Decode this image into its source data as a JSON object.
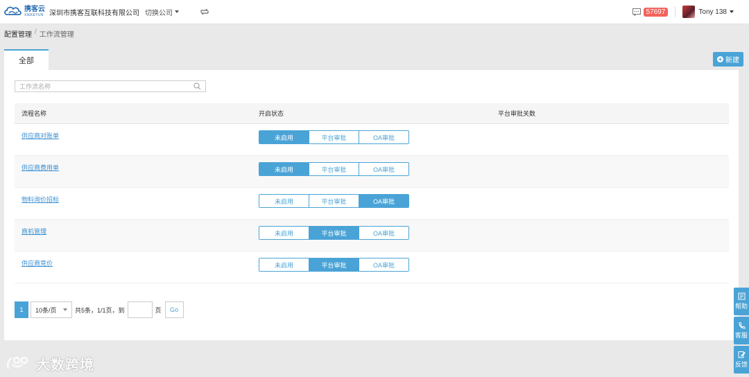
{
  "header": {
    "logo_cn": "携客云",
    "logo_en": "XIEKEYUN",
    "company": "深圳市携客互联科技有限公司",
    "switch_company": "切换公司",
    "message_count": "57697",
    "user_name": "Tony 138"
  },
  "breadcrumb": {
    "root": "配置管理",
    "separator": "/",
    "current": "工作流管理"
  },
  "tabs": {
    "active": "全部"
  },
  "toolbar": {
    "new_label": "新建"
  },
  "search": {
    "placeholder": "工作流名称"
  },
  "table": {
    "headers": [
      "流程名称",
      "开启状态",
      "平台审批关数"
    ],
    "options": [
      "未启用",
      "平台审批",
      "OA审批"
    ],
    "rows": [
      {
        "name": "供应商对账单",
        "status": "未启用"
      },
      {
        "name": "供应商费用单",
        "status": "未启用"
      },
      {
        "name": "物料询价招标",
        "status": "OA审批"
      },
      {
        "name": "商机管理",
        "status": "平台审批"
      },
      {
        "name": "供应商竞价",
        "status": "平台审批"
      }
    ]
  },
  "pagination": {
    "current_page": "1",
    "page_size": "10条/页",
    "info": "共5条，1/1页，到",
    "unit": "页",
    "go": "Go"
  },
  "side_float": {
    "help": "帮助",
    "service": "客服",
    "feedback": "反馈"
  },
  "watermark": {
    "text": "大数跨境"
  },
  "colors": {
    "accent": "#4aa3d6",
    "badge": "#f3635c",
    "link": "#3a8fd0"
  }
}
